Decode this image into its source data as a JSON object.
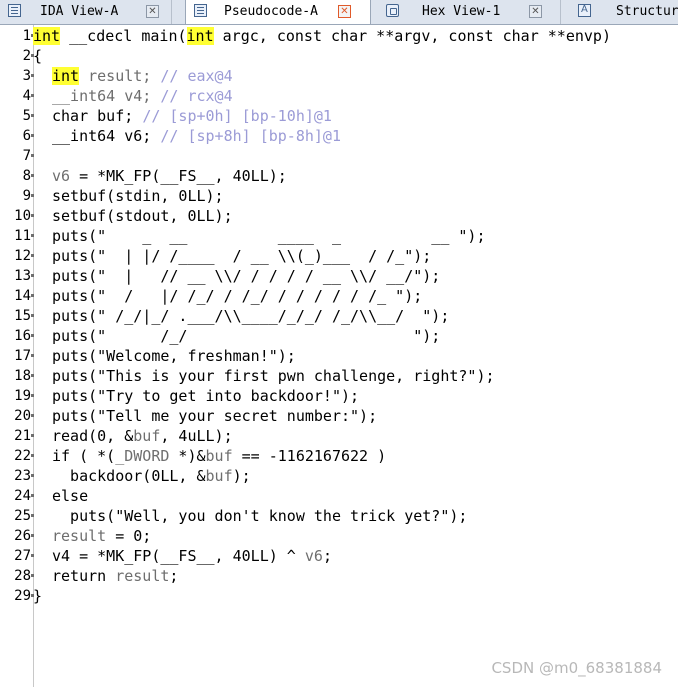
{
  "tabs": [
    {
      "label": "IDA View-A",
      "icon": "graph-view-icon",
      "active": false
    },
    {
      "label": "Pseudocode-A",
      "icon": "pseudocode-icon",
      "active": true
    },
    {
      "label": "Hex View-1",
      "icon": "hex-view-icon",
      "active": false
    },
    {
      "label": "Structur",
      "icon": "structures-icon",
      "active": false
    }
  ],
  "close_glyph": "✕",
  "code": {
    "line_numbers": [
      "1",
      "2",
      "3",
      "4",
      "5",
      "6",
      "7",
      "8",
      "9",
      "10",
      "11",
      "12",
      "13",
      "14",
      "15",
      "16",
      "17",
      "18",
      "19",
      "20",
      "21",
      "22",
      "23",
      "24",
      "25",
      "26",
      "27",
      "28",
      "29"
    ],
    "l1": {
      "kw1": "int",
      "mid": " __cdecl main(",
      "kw2": "int",
      "end": " argc, const char **argv, const char **envp)"
    },
    "l2": "{",
    "l3": {
      "kw": "int",
      "name": " result; ",
      "comment": "// eax@4"
    },
    "l4": {
      "decl": "__int64 v4; ",
      "comment": "// rcx@4"
    },
    "l5": {
      "decl": "char buf; ",
      "comment": "// [sp+0h] [bp-10h]@1"
    },
    "l6": {
      "decl": "__int64 v6; ",
      "comment": "// [sp+8h] [bp-8h]@1"
    },
    "l7": "",
    "l8": {
      "var": "v6",
      "rest": " = *MK_FP(__FS__, 40LL);"
    },
    "l9": "setbuf(stdin, 0LL);",
    "l10": "setbuf(stdout, 0LL);",
    "l11": "puts(\"    _  __          ____  _          __ \");",
    "l12": "puts(\"  | |/ /____  / __ \\\\(_)___  / /_\");",
    "l13": "puts(\"  |   // __ \\\\/ / / / / __ \\\\/ __/\");",
    "l14": "puts(\"  /   |/ /_/ / /_/ / / / / / /_ \");",
    "l15": "puts(\" /_/|_/ .___/\\\\____/_/_/ /_/\\\\__/  \");",
    "l16": "puts(\"      /_/                         \");",
    "l17": "puts(\"Welcome, freshman!\");",
    "l18": "puts(\"This is your first pwn challenge, right?\");",
    "l19": "puts(\"Try to get into backdoor!\");",
    "l20": "puts(\"Tell me your secret number:\");",
    "l21": {
      "a": "read(0, &",
      "var": "buf",
      "b": ", 4uLL);"
    },
    "l22": {
      "a": "if ( *(",
      "type": "_DWORD",
      "b": " *)&",
      "var": "buf",
      "c": " == -1162167622 )"
    },
    "l23": {
      "a": "  backdoor(0LL, &",
      "var": "buf",
      "b": ");"
    },
    "l24": "else",
    "l25": "  puts(\"Well, you don't know the trick yet?\");",
    "l26": {
      "var": "result",
      "rest": " = 0;"
    },
    "l27": {
      "a": "v4 = *MK_FP(__FS__, 40LL) ^ ",
      "var": "v6",
      "b": ";"
    },
    "l28": {
      "a": "return ",
      "var": "result",
      "b": ";"
    },
    "l29": "}"
  },
  "watermark": "CSDN @m0_68381884",
  "colors": {
    "highlight": "#ffff33",
    "comment": "#9b9bd6",
    "variable": "#2c2cbf",
    "close_active": "#e05a2a"
  }
}
